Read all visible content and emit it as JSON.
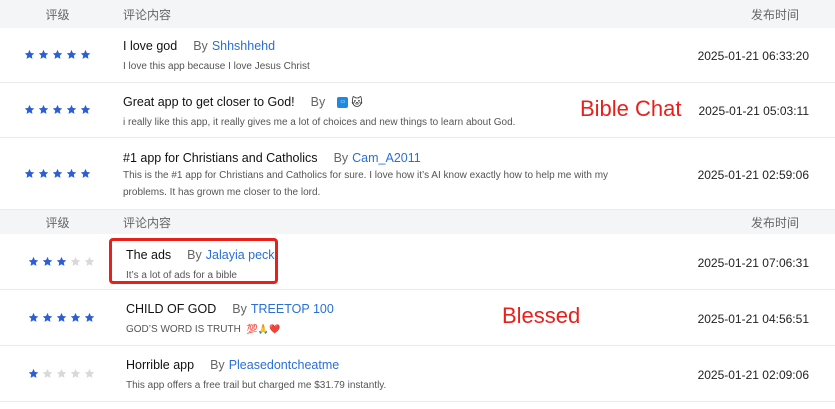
{
  "table1": {
    "header": {
      "rating": "评级",
      "content": "评论内容",
      "time": "发布时间"
    },
    "rows": [
      {
        "rating": 5,
        "title": "I love god",
        "by": "By",
        "author": "Shhshhehd",
        "body": "I love this app because I love Jesus Christ",
        "time": "2025-01-21 06:33:20"
      },
      {
        "rating": 5,
        "title": "Great app to get closer to God!",
        "by": "By",
        "author": "",
        "author_icons": [
          "blue-app-icon",
          "yellow-emoji-icon"
        ],
        "body": "i really like this app, it really gives me a lot of choices and new things to learn about God.",
        "time": "2025-01-21 05:03:11"
      },
      {
        "rating": 5,
        "title": "#1 app for Christians and Catholics",
        "by": "By",
        "author": "Cam_A2011",
        "body": "This is the #1 app for Christians and Catholics for sure. I love how it’s AI know exactly how to help me with my problems. It has grown me closer to the lord.",
        "time": "2025-01-21 02:59:06"
      }
    ],
    "overlay_label": "Bible Chat"
  },
  "table2": {
    "header": {
      "rating": "评级",
      "content": "评论内容",
      "time": "发布时间"
    },
    "rows": [
      {
        "rating": 3,
        "title": "The ads",
        "by": "By",
        "author": "Jalayia peck",
        "body": "It’s a lot of ads for a bible",
        "time": "2025-01-21 07:06:31"
      },
      {
        "rating": 5,
        "title": "CHILD OF GOD",
        "by": "By",
        "author": "TREETOP 100",
        "body": "GOD’S WORD IS TRUTH",
        "body_emojis": "💯🙏❤️",
        "time": "2025-01-21 04:56:51"
      },
      {
        "rating": 1,
        "title": "Horrible app",
        "by": "By",
        "author": "Pleasedontcheatme",
        "body": "This app offers a free trail but charged me $31.79 instantly.",
        "time": "2025-01-21 02:09:06"
      }
    ],
    "overlay_label": "Blessed"
  },
  "colors": {
    "star_filled": "#2a5fd8",
    "star_empty": "#d9d9d9",
    "accent_red": "#e8201c",
    "link": "#2a6fd6"
  }
}
